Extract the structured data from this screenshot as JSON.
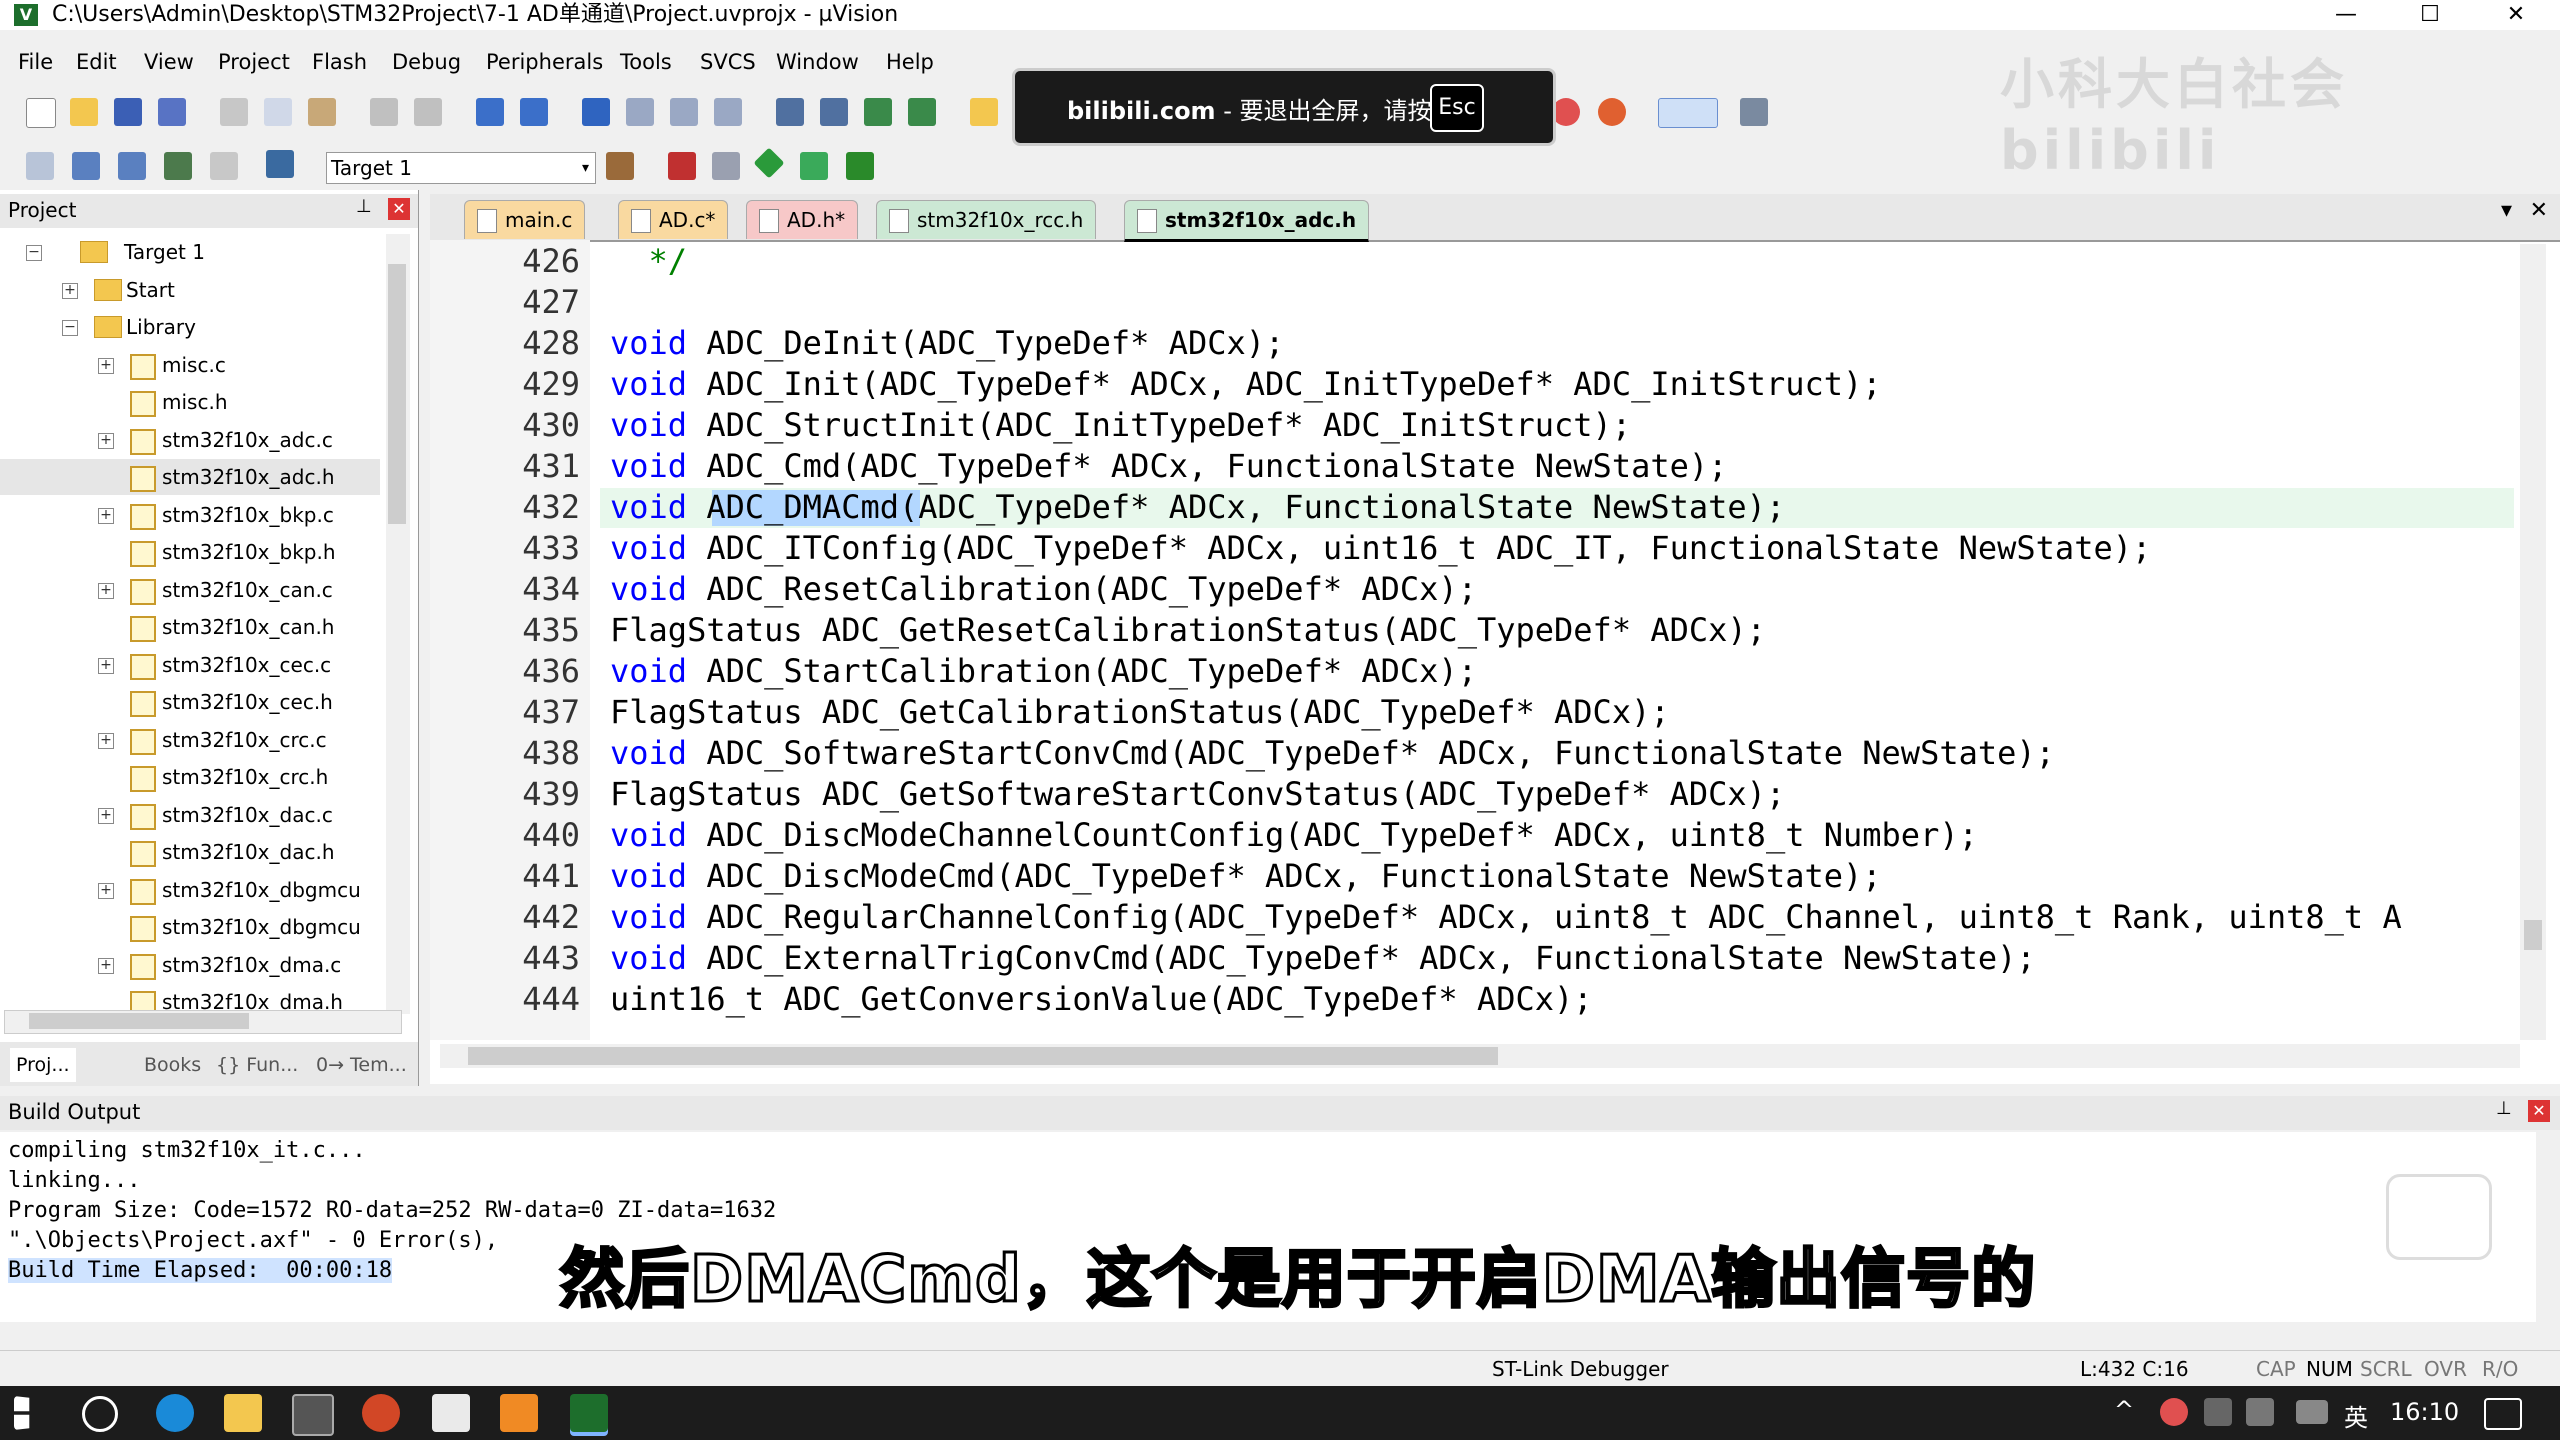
{
  "window": {
    "title": "C:\\Users\\Admin\\Desktop\\STM32Project\\7-1 AD单通道\\Project.uvprojx - µVision",
    "minimize": "—",
    "maximize": "☐",
    "close": "✕"
  },
  "menu": [
    "File",
    "Edit",
    "View",
    "Project",
    "Flash",
    "Debug",
    "Peripherals",
    "Tools",
    "SVCS",
    "Window",
    "Help"
  ],
  "toolbar": {
    "target": "Target 1"
  },
  "overlay": {
    "site": "bilibili.com",
    "message": " - 要退出全屏，请按",
    "key": "Esc",
    "watermark": "小科大白社会 bilibili"
  },
  "project_panel": {
    "title": "Project",
    "tree": [
      {
        "label": "Target 1",
        "level": 0,
        "kind": "target",
        "expander": "−"
      },
      {
        "label": "Start",
        "level": 1,
        "kind": "folder",
        "expander": "+"
      },
      {
        "label": "Library",
        "level": 1,
        "kind": "folder",
        "expander": "−"
      },
      {
        "label": "misc.c",
        "level": 2,
        "kind": "file",
        "expander": "+"
      },
      {
        "label": "misc.h",
        "level": 2,
        "kind": "file",
        "expander": ""
      },
      {
        "label": "stm32f10x_adc.c",
        "level": 2,
        "kind": "file",
        "expander": "+"
      },
      {
        "label": "stm32f10x_adc.h",
        "level": 2,
        "kind": "file",
        "expander": ""
      },
      {
        "label": "stm32f10x_bkp.c",
        "level": 2,
        "kind": "file",
        "expander": "+"
      },
      {
        "label": "stm32f10x_bkp.h",
        "level": 2,
        "kind": "file",
        "expander": ""
      },
      {
        "label": "stm32f10x_can.c",
        "level": 2,
        "kind": "file",
        "expander": "+"
      },
      {
        "label": "stm32f10x_can.h",
        "level": 2,
        "kind": "file",
        "expander": ""
      },
      {
        "label": "stm32f10x_cec.c",
        "level": 2,
        "kind": "file",
        "expander": "+"
      },
      {
        "label": "stm32f10x_cec.h",
        "level": 2,
        "kind": "file",
        "expander": ""
      },
      {
        "label": "stm32f10x_crc.c",
        "level": 2,
        "kind": "file",
        "expander": "+"
      },
      {
        "label": "stm32f10x_crc.h",
        "level": 2,
        "kind": "file",
        "expander": ""
      },
      {
        "label": "stm32f10x_dac.c",
        "level": 2,
        "kind": "file",
        "expander": "+"
      },
      {
        "label": "stm32f10x_dac.h",
        "level": 2,
        "kind": "file",
        "expander": ""
      },
      {
        "label": "stm32f10x_dbgmcu",
        "level": 2,
        "kind": "file",
        "expander": "+"
      },
      {
        "label": "stm32f10x_dbgmcu",
        "level": 2,
        "kind": "file",
        "expander": ""
      },
      {
        "label": "stm32f10x_dma.c",
        "level": 2,
        "kind": "file",
        "expander": "+"
      },
      {
        "label": "stm32f10x_dma.h",
        "level": 2,
        "kind": "file",
        "expander": ""
      }
    ],
    "tabs": [
      "Proj...",
      "Books",
      "{} Fun...",
      "0→ Tem..."
    ]
  },
  "editor": {
    "tabs": [
      {
        "label": "main.c",
        "active": false,
        "color": "#f9d9a0"
      },
      {
        "label": "AD.c*",
        "active": false,
        "color": "#f9d9a0"
      },
      {
        "label": "AD.h*",
        "active": false,
        "color": "#f7c8c8"
      },
      {
        "label": "stm32f10x_rcc.h",
        "active": false,
        "color": "#cce8d4"
      },
      {
        "label": "stm32f10x_adc.h",
        "active": true,
        "color": "#cce8d4"
      }
    ],
    "tab_menu": "▾",
    "tab_close": "✕",
    "current_line": "432",
    "lines": [
      {
        "n": "426",
        "kw": "",
        "text": "  */"
      },
      {
        "n": "427",
        "kw": "",
        "text": ""
      },
      {
        "n": "428",
        "kw": "void",
        "text": " ADC_DeInit(ADC_TypeDef* ADCx);"
      },
      {
        "n": "429",
        "kw": "void",
        "text": " ADC_Init(ADC_TypeDef* ADCx, ADC_InitTypeDef* ADC_InitStruct);"
      },
      {
        "n": "430",
        "kw": "void",
        "text": " ADC_StructInit(ADC_InitTypeDef* ADC_InitStruct);"
      },
      {
        "n": "431",
        "kw": "void",
        "text": " ADC_Cmd(ADC_TypeDef* ADCx, FunctionalState NewState);"
      },
      {
        "n": "432",
        "kw": "void",
        "text": " ADC_DMACmd(ADC_TypeDef* ADCx, FunctionalState NewState);"
      },
      {
        "n": "433",
        "kw": "void",
        "text": " ADC_ITConfig(ADC_TypeDef* ADCx, uint16_t ADC_IT, FunctionalState NewState);"
      },
      {
        "n": "434",
        "kw": "void",
        "text": " ADC_ResetCalibration(ADC_TypeDef* ADCx);"
      },
      {
        "n": "435",
        "kw": "",
        "text": "FlagStatus ADC_GetResetCalibrationStatus(ADC_TypeDef* ADCx);"
      },
      {
        "n": "436",
        "kw": "void",
        "text": " ADC_StartCalibration(ADC_TypeDef* ADCx);"
      },
      {
        "n": "437",
        "kw": "",
        "text": "FlagStatus ADC_GetCalibrationStatus(ADC_TypeDef* ADCx);"
      },
      {
        "n": "438",
        "kw": "void",
        "text": " ADC_SoftwareStartConvCmd(ADC_TypeDef* ADCx, FunctionalState NewState);"
      },
      {
        "n": "439",
        "kw": "",
        "text": "FlagStatus ADC_GetSoftwareStartConvStatus(ADC_TypeDef* ADCx);"
      },
      {
        "n": "440",
        "kw": "void",
        "text": " ADC_DiscModeChannelCountConfig(ADC_TypeDef* ADCx, uint8_t Number);"
      },
      {
        "n": "441",
        "kw": "void",
        "text": " ADC_DiscModeCmd(ADC_TypeDef* ADCx, FunctionalState NewState);"
      },
      {
        "n": "442",
        "kw": "void",
        "text": " ADC_RegularChannelConfig(ADC_TypeDef* ADCx, uint8_t ADC_Channel, uint8_t Rank, uint8_t A"
      },
      {
        "n": "443",
        "kw": "void",
        "text": " ADC_ExternalTrigConvCmd(ADC_TypeDef* ADCx, FunctionalState NewState);"
      },
      {
        "n": "444",
        "kw": "",
        "text": "uint16_t ADC_GetConversionValue(ADC_TypeDef* ADCx);"
      }
    ]
  },
  "build_output": {
    "title": "Build Output",
    "lines": [
      "compiling stm32f10x_it.c...",
      "linking...",
      "Program Size: Code=1572 RO-data=252 RW-data=0 ZI-data=1632",
      "\".\\Objects\\Project.axf\" - 0 Error(s),",
      "Build Time Elapsed:  00:00:18"
    ],
    "subtitle": "然后DMACmd，这个是用于开启DMA输出信号的"
  },
  "statusbar": {
    "debugger": "ST-Link Debugger",
    "position": "L:432 C:16",
    "indicators": [
      "CAP",
      "NUM",
      "SCRL",
      "OVR",
      "R/O"
    ]
  },
  "taskbar": {
    "ime": "英",
    "time": "16:10"
  }
}
